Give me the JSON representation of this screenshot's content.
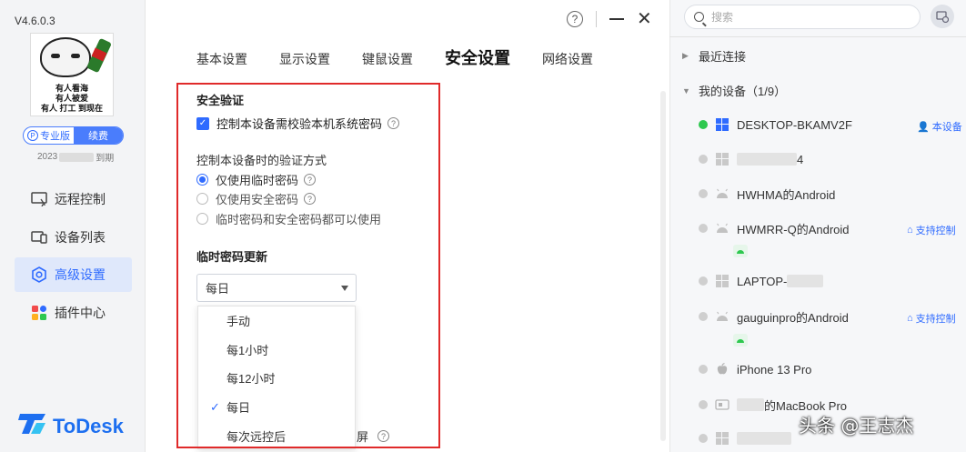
{
  "app": {
    "version": "V4.6.0.3",
    "brand": "ToDesk",
    "accent_color": "#2f6bff"
  },
  "profile": {
    "avatar_caption_line1": "有人看海",
    "avatar_caption_line2": "有人被爱",
    "avatar_caption_line3": "有人 打工 到现在",
    "plan_label": "专业版",
    "renew_label": "续费",
    "expire_prefix": "2023",
    "expire_suffix": "到期"
  },
  "sidebar": {
    "items": [
      {
        "label": "远程控制",
        "icon": "remote-control-icon",
        "active": false
      },
      {
        "label": "设备列表",
        "icon": "device-list-icon",
        "active": false
      },
      {
        "label": "高级设置",
        "icon": "advanced-settings-icon",
        "active": true
      },
      {
        "label": "插件中心",
        "icon": "plugin-center-icon",
        "active": false
      }
    ]
  },
  "window": {
    "help_label": "?",
    "close_label": "✕"
  },
  "tabs": [
    {
      "label": "基本设置",
      "active": false
    },
    {
      "label": "显示设置",
      "active": false
    },
    {
      "label": "键鼠设置",
      "active": false
    },
    {
      "label": "安全设置",
      "active": true
    },
    {
      "label": "网络设置",
      "active": false
    }
  ],
  "security": {
    "verify_title": "安全验证",
    "verify_checkbox_label": "控制本设备需校验本机系统密码",
    "verify_checked": true,
    "method_title": "控制本设备时的验证方式",
    "methods": [
      {
        "label": "仅使用临时密码",
        "selected": true,
        "has_help": true
      },
      {
        "label": "仅使用安全密码",
        "selected": false,
        "has_help": true
      },
      {
        "label": "临时密码和安全密码都可以使用",
        "selected": false,
        "has_help": false
      }
    ],
    "temp_update_title": "临时密码更新",
    "temp_update_value": "每日",
    "temp_update_options": [
      {
        "label": "手动",
        "selected": false
      },
      {
        "label": "每1小时",
        "selected": false
      },
      {
        "label": "每12小时",
        "selected": false
      },
      {
        "label": "每日",
        "selected": true
      },
      {
        "label": "每次远控后",
        "selected": false
      }
    ],
    "hidden_option_tail": "屏"
  },
  "device_panel": {
    "search_placeholder": "搜索",
    "recent_group": "最近连接",
    "my_devices_group": "我的设备（1/9）",
    "devices": [
      {
        "name": "DESKTOP-BKAMV2F",
        "online": true,
        "os": "windows",
        "badge": "本设备"
      },
      {
        "name": "4",
        "online": false,
        "os": "windows",
        "badge": ""
      },
      {
        "name": "HWHMA的Android",
        "online": false,
        "os": "android",
        "badge": ""
      },
      {
        "name": "HWMRR-Q的Android",
        "online": false,
        "os": "android",
        "badge": "支持控制"
      },
      {
        "name": "LAPTOP-",
        "online": false,
        "os": "windows",
        "badge": ""
      },
      {
        "name": "gauguinpro的Android",
        "online": false,
        "os": "android",
        "badge": "支持控制"
      },
      {
        "name": "iPhone 13 Pro",
        "online": false,
        "os": "apple",
        "badge": ""
      },
      {
        "name": "的MacBook Pro",
        "online": false,
        "os": "mac",
        "badge": ""
      },
      {
        "name": "",
        "online": false,
        "os": "windows",
        "badge": ""
      }
    ]
  },
  "watermark": "头条 @王志杰"
}
